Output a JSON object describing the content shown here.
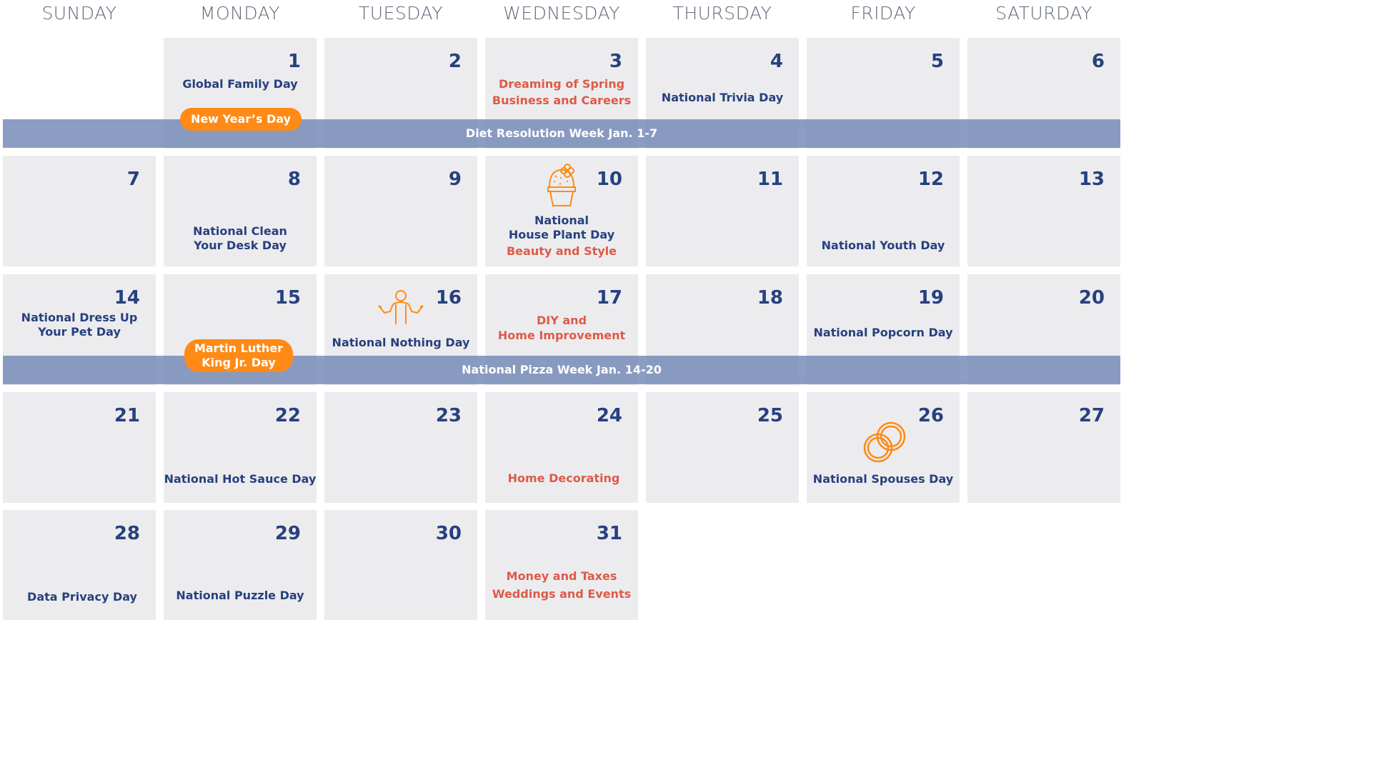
{
  "days_of_week": [
    "SUNDAY",
    "MONDAY",
    "TUESDAY",
    "WEDNESDAY",
    "THURSDAY",
    "FRIDAY",
    "SATURDAY"
  ],
  "colors": {
    "cell_bg": "#ececee",
    "number": "#27407f",
    "event_blue": "#27407f",
    "event_red": "#de5a47",
    "band": "#8896bb",
    "pill": "#ff8a16",
    "icon": "#ff8a16"
  },
  "days": {
    "d1": {
      "num": "1",
      "events": [
        "Global Family Day"
      ]
    },
    "d2": {
      "num": "2"
    },
    "d3": {
      "num": "3",
      "events": [
        "Dreaming of Spring",
        "Business and Careers"
      ]
    },
    "d4": {
      "num": "4",
      "events": [
        "National Trivia Day"
      ]
    },
    "d5": {
      "num": "5"
    },
    "d6": {
      "num": "6"
    },
    "d7": {
      "num": "7"
    },
    "d8": {
      "num": "8",
      "events": [
        "National Clean",
        "Your Desk Day"
      ]
    },
    "d9": {
      "num": "9"
    },
    "d10": {
      "num": "10",
      "events": [
        "National",
        "House Plant Day",
        "Beauty and Style"
      ],
      "icon": "cactus-plant-icon"
    },
    "d11": {
      "num": "11"
    },
    "d12": {
      "num": "12",
      "events": [
        "National Youth Day"
      ]
    },
    "d13": {
      "num": "13"
    },
    "d14": {
      "num": "14",
      "events": [
        "National Dress Up",
        "Your Pet Day"
      ]
    },
    "d15": {
      "num": "15"
    },
    "d16": {
      "num": "16",
      "events": [
        "National Nothing Day"
      ],
      "icon": "shrugging-person-icon"
    },
    "d17": {
      "num": "17",
      "events": [
        "DIY and",
        "Home Improvement"
      ]
    },
    "d18": {
      "num": "18"
    },
    "d19": {
      "num": "19",
      "events": [
        "National Popcorn Day"
      ]
    },
    "d20": {
      "num": "20"
    },
    "d21": {
      "num": "21"
    },
    "d22": {
      "num": "22",
      "events": [
        "National Hot Sauce Day"
      ]
    },
    "d23": {
      "num": "23"
    },
    "d24": {
      "num": "24",
      "events": [
        "Home Decorating"
      ]
    },
    "d25": {
      "num": "25"
    },
    "d26": {
      "num": "26",
      "events": [
        "National Spouses Day"
      ],
      "icon": "wedding-rings-icon"
    },
    "d27": {
      "num": "27"
    },
    "d28": {
      "num": "28",
      "events": [
        "Data Privacy Day"
      ]
    },
    "d29": {
      "num": "29",
      "events": [
        "National Puzzle Day"
      ]
    },
    "d30": {
      "num": "30"
    },
    "d31": {
      "num": "31",
      "events": [
        "Money and Taxes",
        "Weddings and Events"
      ]
    }
  },
  "bands": {
    "week1": "Diet Resolution Week Jan. 1-7",
    "week3": "National Pizza Week Jan. 14-20"
  },
  "holidays": {
    "new_year": "New Year’s Day",
    "mlk_line1": "Martin Luther",
    "mlk_line2": "King Jr. Day"
  }
}
